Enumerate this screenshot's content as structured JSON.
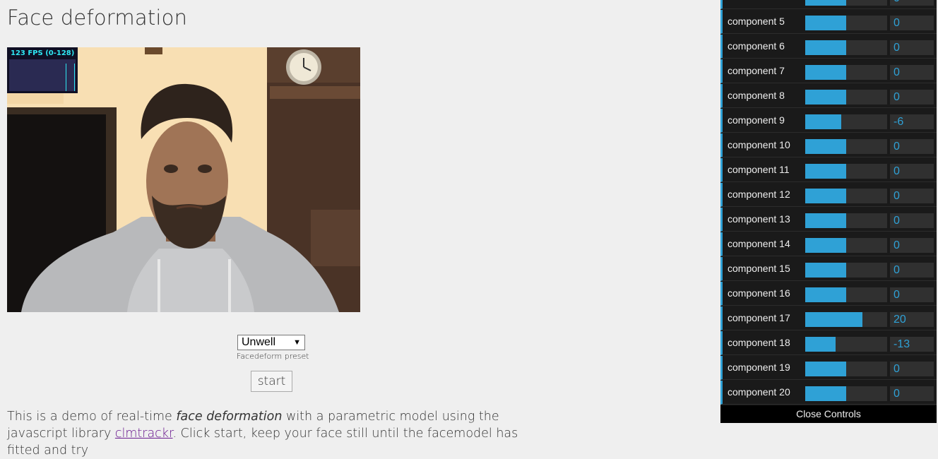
{
  "page": {
    "title": "Face deformation"
  },
  "stats": {
    "fps_label": "123 FPS (0-128)"
  },
  "preset": {
    "selected": "Unwell",
    "caption": "Facedeform preset"
  },
  "start_button": "start",
  "description": {
    "part1": "This is a demo of real-time ",
    "italic": "face deformation",
    "part2": " with a parametric model using the javascript library ",
    "link": "clmtrackr",
    "part3": ". Click start, keep your face still until the facemodel has fitted and try"
  },
  "controls": {
    "partial_row_value": "0",
    "rows": [
      {
        "label": "component 5",
        "value": "0"
      },
      {
        "label": "component 6",
        "value": "0"
      },
      {
        "label": "component 7",
        "value": "0"
      },
      {
        "label": "component 8",
        "value": "0"
      },
      {
        "label": "component 9",
        "value": "-6"
      },
      {
        "label": "component 10",
        "value": "0"
      },
      {
        "label": "component 11",
        "value": "0"
      },
      {
        "label": "component 12",
        "value": "0"
      },
      {
        "label": "component 13",
        "value": "0"
      },
      {
        "label": "component 14",
        "value": "0"
      },
      {
        "label": "component 15",
        "value": "0"
      },
      {
        "label": "component 16",
        "value": "0"
      },
      {
        "label": "component 17",
        "value": "20"
      },
      {
        "label": "component 18",
        "value": "-13"
      },
      {
        "label": "component 19",
        "value": "0"
      },
      {
        "label": "component 20",
        "value": "0"
      }
    ],
    "close_label": "Close Controls"
  },
  "colors": {
    "accent": "#2fa1d6",
    "panel_bg": "#1a1a1a",
    "fps_text": "#2ee7f2"
  }
}
